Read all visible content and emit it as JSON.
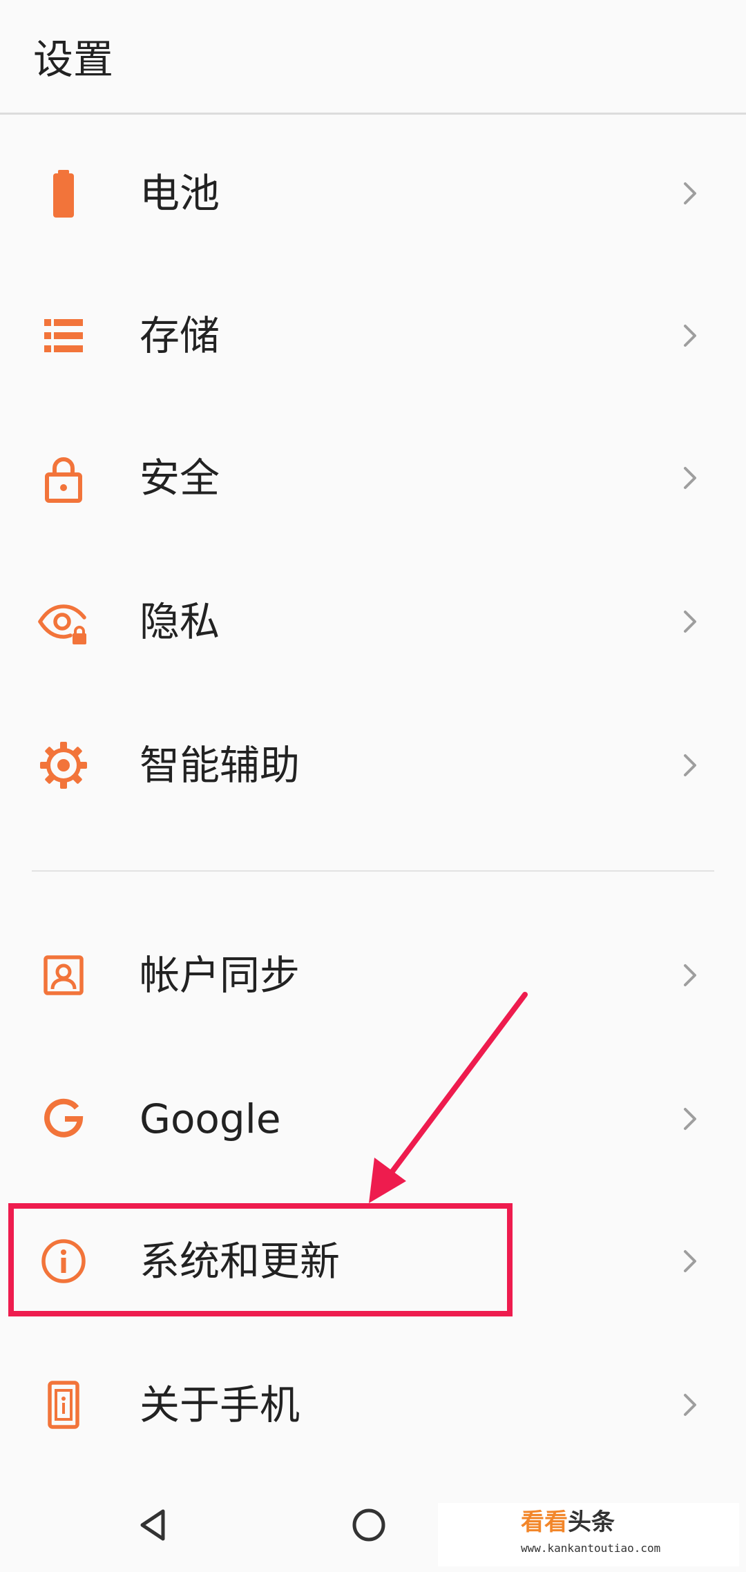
{
  "header": {
    "title": "设置"
  },
  "colors": {
    "accent": "#f2743a",
    "highlight": "#ee1c4e",
    "chevron": "#9e9e9e"
  },
  "list": {
    "items": [
      {
        "label": "电池",
        "icon": "battery-icon"
      },
      {
        "label": "存储",
        "icon": "storage-icon"
      },
      {
        "label": "安全",
        "icon": "lock-icon"
      },
      {
        "label": "隐私",
        "icon": "privacy-eye-lock-icon"
      },
      {
        "label": "智能辅助",
        "icon": "gear-icon"
      },
      {
        "label": "帐户同步",
        "icon": "account-icon"
      },
      {
        "label": "Google",
        "icon": "google-icon"
      },
      {
        "label": "系统和更新",
        "icon": "info-icon"
      },
      {
        "label": "关于手机",
        "icon": "phone-icon"
      }
    ]
  },
  "navbar": {
    "buttons": [
      "back-icon",
      "home-icon"
    ]
  },
  "watermark": {
    "name_part1": "看看",
    "name_part2": "头条",
    "url": "www.kankantoutiao.com"
  }
}
